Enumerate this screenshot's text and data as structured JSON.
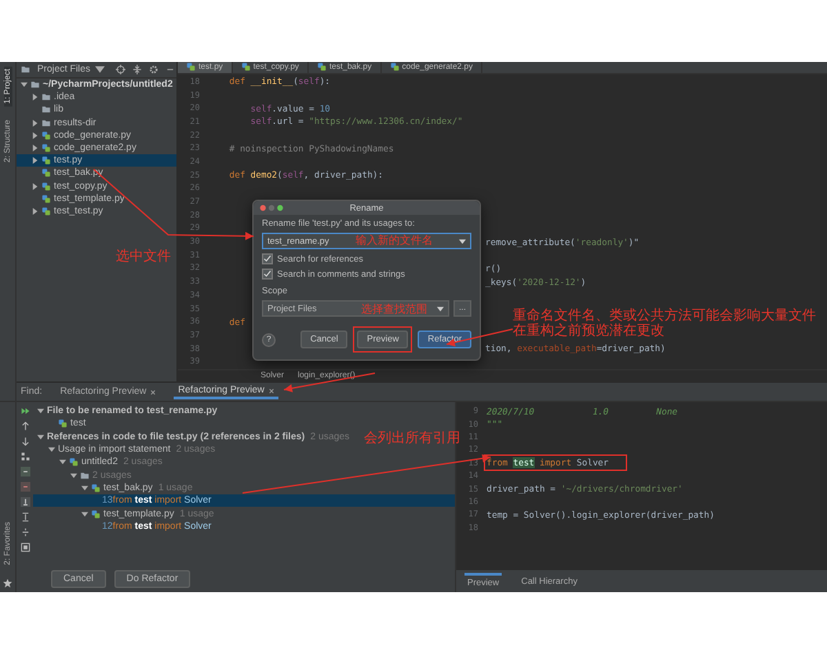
{
  "tool_windows": [
    {
      "label": "1: Project",
      "selected": true
    },
    {
      "label": "2: Structure",
      "selected": false
    }
  ],
  "favorites": {
    "label": "2: Favorites"
  },
  "project": {
    "title": "Project Files",
    "tree": [
      {
        "label": "~/PycharmProjects/untitled2",
        "kind": "root",
        "expanded": true,
        "selected": false,
        "children": [
          {
            "label": ".idea",
            "kind": "folder",
            "expanded": false,
            "selected": false
          },
          {
            "label": "lib",
            "kind": "folder",
            "selected": false
          },
          {
            "label": "results-dir",
            "kind": "folder",
            "expanded": false,
            "selected": false
          },
          {
            "label": "code_generate.py",
            "kind": "py",
            "expanded": false,
            "selected": false
          },
          {
            "label": "code_generate2.py",
            "kind": "py",
            "expanded": false,
            "selected": false
          },
          {
            "label": "test.py",
            "kind": "py",
            "expanded": false,
            "selected": true
          },
          {
            "label": "test_bak.py",
            "kind": "py",
            "selected": false
          },
          {
            "label": "test_copy.py",
            "kind": "py",
            "expanded": false,
            "selected": false
          },
          {
            "label": "test_template.py",
            "kind": "py",
            "selected": false
          },
          {
            "label": "test_test.py",
            "kind": "py",
            "expanded": false,
            "selected": false
          }
        ]
      }
    ]
  },
  "editor": {
    "tabs": [
      {
        "label": "test.py",
        "selected": true
      },
      {
        "label": "test_copy.py",
        "selected": false
      },
      {
        "label": "test_bak.py",
        "selected": false
      },
      {
        "label": "code_generate2.py",
        "selected": false
      }
    ],
    "lines": [
      {
        "number": "18",
        "segments": [
          {
            "kind": "kw",
            "text": "    def "
          },
          {
            "kind": "fn",
            "text": "__init__"
          },
          {
            "kind": "plain",
            "text": "("
          },
          {
            "kind": "self",
            "text": "self"
          },
          {
            "kind": "plain",
            "text": "):"
          }
        ]
      },
      {
        "number": "19"
      },
      {
        "number": "20",
        "segments": [
          {
            "kind": "self",
            "text": "        self"
          },
          {
            "kind": "plain",
            "text": ".value = "
          },
          {
            "kind": "num",
            "text": "10"
          }
        ]
      },
      {
        "number": "21",
        "segments": [
          {
            "kind": "self",
            "text": "        self"
          },
          {
            "kind": "plain",
            "text": ".url = "
          },
          {
            "kind": "str",
            "text": "\"https://www.12306.cn/index/\""
          }
        ]
      },
      {
        "number": "22"
      },
      {
        "number": "23",
        "segments": [
          {
            "kind": "cm",
            "text": "    # noinspection PyShadowingNames"
          }
        ]
      },
      {
        "number": "24"
      },
      {
        "number": "25",
        "segments": [
          {
            "kind": "kw",
            "text": "    def "
          },
          {
            "kind": "fn",
            "text": "demo2"
          },
          {
            "kind": "plain",
            "text": "("
          },
          {
            "kind": "self",
            "text": "self"
          },
          {
            "kind": "plain",
            "text": ", driver_path):"
          }
        ]
      },
      {
        "number": "26"
      },
      {
        "number": "27"
      },
      {
        "number": "28"
      },
      {
        "number": "29"
      },
      {
        "number": "30",
        "partial": true,
        "segments": [
          {
            "kind": "plain",
            "text": "remove_attribute("
          },
          {
            "kind": "str",
            "text": "'readonly'"
          },
          {
            "kind": "plain",
            "text": ")\""
          }
        ]
      },
      {
        "number": "31"
      },
      {
        "number": "32",
        "partial": true,
        "segments": [
          {
            "kind": "plain",
            "text": "r()"
          }
        ]
      },
      {
        "number": "33",
        "partial": true,
        "segments": [
          {
            "kind": "plain",
            "text": "_keys("
          },
          {
            "kind": "str",
            "text": "'2020-12-12'"
          },
          {
            "kind": "plain",
            "text": ")"
          }
        ]
      },
      {
        "number": "34"
      },
      {
        "number": "35"
      },
      {
        "number": "36",
        "segments": [
          {
            "kind": "kw",
            "text": "    def"
          }
        ]
      },
      {
        "number": "37"
      },
      {
        "number": "38",
        "partial": true,
        "segments": [
          {
            "kind": "plain",
            "text": "tion, "
          },
          {
            "kind": "param",
            "text": "executable_path"
          },
          {
            "kind": "plain",
            "text": "=driver_path)"
          }
        ]
      },
      {
        "number": "39"
      }
    ],
    "breadcrumb": [
      "Solver",
      "login_explorer()"
    ]
  },
  "dialog": {
    "title": "Rename",
    "prompt": "Rename file 'test.py' and its usages to:",
    "value": "test_rename.py",
    "options": [
      {
        "label": "Search for references",
        "checked": true
      },
      {
        "label": "Search in comments and strings",
        "checked": true
      }
    ],
    "scope_label": "Scope",
    "scope": "Project Files",
    "browse": "...",
    "help": "?",
    "buttons": [
      {
        "label": "Cancel",
        "kind": "normal"
      },
      {
        "label": "Preview",
        "kind": "flagged"
      },
      {
        "label": "Refactor",
        "kind": "primary"
      }
    ]
  },
  "find": {
    "label": "Find:",
    "tabs": [
      {
        "label": "Refactoring Preview",
        "selected": false
      },
      {
        "label": "Refactoring Preview",
        "selected": true
      }
    ],
    "tree": [
      {
        "label": "File to be renamed to test_rename.py",
        "kind": "heading",
        "expanded": true,
        "selected": false,
        "children": [
          {
            "label": "test",
            "kind": "py",
            "selected": false
          }
        ]
      },
      {
        "label": "References in code to file test.py (2 references in 2 files)",
        "count": "2 usages",
        "kind": "heading",
        "expanded": true,
        "selected": false,
        "children": [
          {
            "label": "Usage in import statement",
            "count": "2 usages",
            "kind": "group",
            "expanded": true,
            "selected": false,
            "children": [
              {
                "label": "untitled2",
                "count": "2 usages",
                "kind": "module",
                "expanded": true,
                "selected": false,
                "children": [
                  {
                    "count": "2 usages",
                    "kind": "folder",
                    "expanded": true,
                    "selected": false,
                    "children": [
                      {
                        "label": "test_bak.py",
                        "count": "1 usage",
                        "kind": "py",
                        "expanded": true,
                        "selected": false,
                        "children": [
                          {
                            "kind": "usage",
                            "number": "13",
                            "selected": true,
                            "segments": [
                              {
                                "kind": "kw",
                                "text": "from "
                              },
                              {
                                "kind": "match",
                                "text": "test"
                              },
                              {
                                "kind": "kw",
                                "text": " import "
                              },
                              {
                                "kind": "cls",
                                "text": "Solver"
                              }
                            ]
                          }
                        ]
                      },
                      {
                        "label": "test_template.py",
                        "count": "1 usage",
                        "kind": "py",
                        "expanded": true,
                        "selected": false,
                        "children": [
                          {
                            "kind": "usage",
                            "number": "12",
                            "selected": false,
                            "segments": [
                              {
                                "kind": "kw",
                                "text": "from "
                              },
                              {
                                "kind": "match",
                                "text": "test"
                              },
                              {
                                "kind": "kw",
                                "text": " import "
                              },
                              {
                                "kind": "cls",
                                "text": "Solver"
                              }
                            ]
                          }
                        ]
                      }
                    ]
                  }
                ]
              }
            ]
          }
        ]
      }
    ],
    "buttons": [
      "Cancel",
      "Do Refactor"
    ],
    "preview": {
      "lines": [
        {
          "number": "9",
          "segments": [
            {
              "kind": "doc",
              "text": "2020/7/10           1.0         None"
            }
          ]
        },
        {
          "number": "10",
          "segments": [
            {
              "kind": "doc",
              "text": "\"\"\""
            }
          ]
        },
        {
          "number": "11"
        },
        {
          "number": "12"
        },
        {
          "number": "13",
          "marked": true,
          "segments": [
            {
              "kind": "kw",
              "text": "from "
            },
            {
              "kind": "hit",
              "text": "test"
            },
            {
              "kind": "kw",
              "text": " import "
            },
            {
              "kind": "plain",
              "text": "Solver"
            }
          ]
        },
        {
          "number": "14"
        },
        {
          "number": "15",
          "segments": [
            {
              "kind": "plain",
              "text": "driver_path = "
            },
            {
              "kind": "str",
              "text": "'~/drivers/chromdriver'"
            }
          ]
        },
        {
          "number": "16"
        },
        {
          "number": "17",
          "segments": [
            {
              "kind": "plain",
              "text": "temp = Solver().login_explorer(driver_path)"
            }
          ]
        },
        {
          "number": "18"
        }
      ],
      "tabs": [
        {
          "label": "Preview",
          "selected": true
        },
        {
          "label": "Call Hierarchy",
          "selected": false
        }
      ]
    }
  },
  "annotations": [
    {
      "kind": "file-note",
      "text": "选中文件"
    },
    {
      "kind": "name-note",
      "text": "输入新的文件名"
    },
    {
      "kind": "scope-note",
      "text": "选择查找范围"
    },
    {
      "kind": "preview-note",
      "lines": [
        "重命名文件名、类或公共方法可能会影响大量文件",
        "在重构之前预览潜在更改"
      ]
    },
    {
      "kind": "usage-note",
      "text": "会列出所有引用"
    }
  ]
}
